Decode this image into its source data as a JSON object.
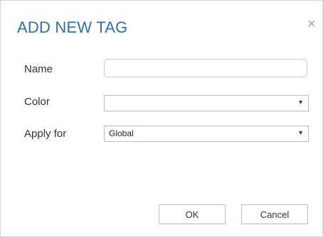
{
  "dialog": {
    "title": "ADD NEW TAG",
    "close_icon": "close-icon",
    "fields": {
      "name": {
        "label": "Name",
        "value": "",
        "placeholder": ""
      },
      "color": {
        "label": "Color",
        "selected": ""
      },
      "apply_for": {
        "label": "Apply for",
        "selected": "Global"
      }
    },
    "buttons": {
      "ok_label": "OK",
      "cancel_label": "Cancel"
    },
    "colors": {
      "title": "#2a6fb6",
      "border": "#bdbdbd"
    }
  }
}
